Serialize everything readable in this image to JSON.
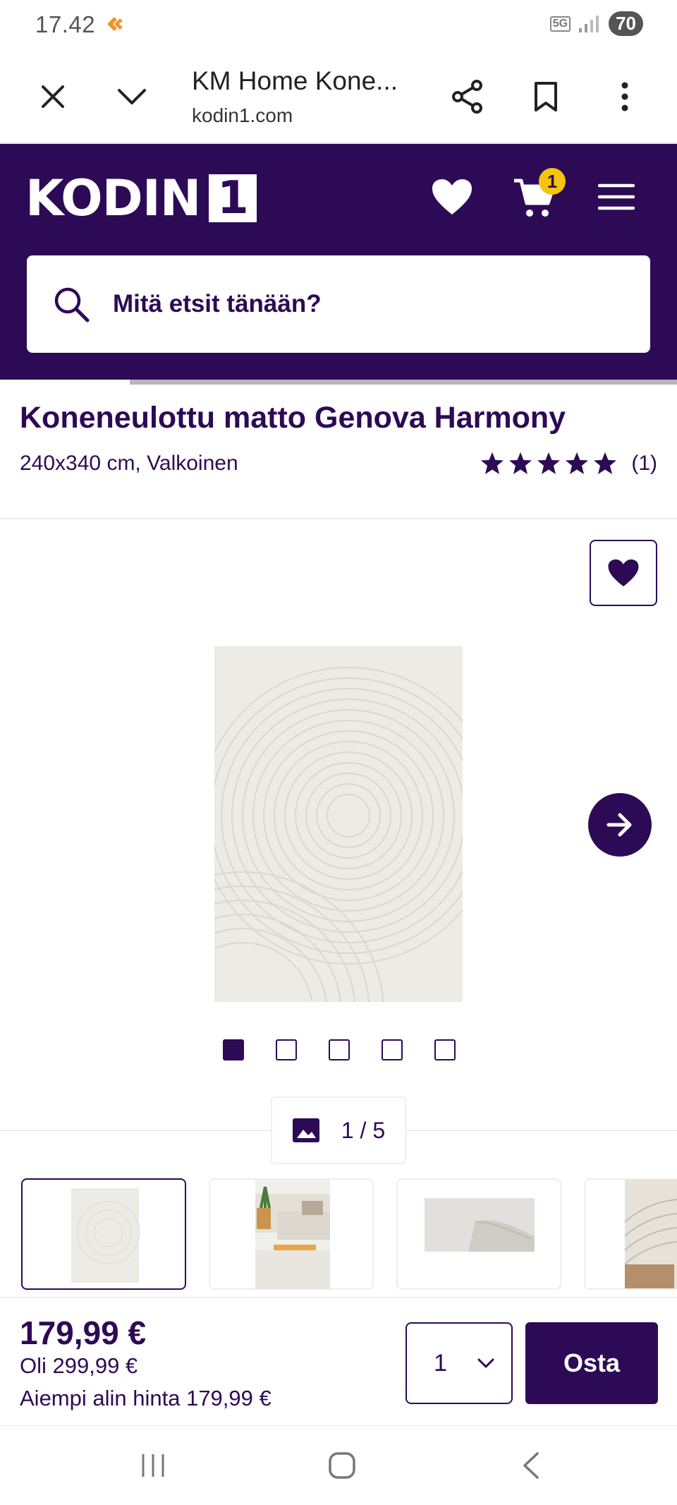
{
  "status_bar": {
    "time": "17.42",
    "network": "5G",
    "battery": "70"
  },
  "browser": {
    "title": "KM Home Kone...",
    "url": "kodin1.com"
  },
  "site": {
    "logo_text": "KODIN",
    "logo_box": "1",
    "cart_count": "1",
    "search_placeholder": "Mitä etsit tänään?",
    "brand_color": "#2d0a55",
    "badge_color": "#f6c30d"
  },
  "product": {
    "title": "Koneneulottu matto Genova Harmony",
    "subtitle": "240x340 cm, Valkoinen",
    "rating": 5,
    "rating_count": "(1)"
  },
  "gallery": {
    "counter": "1 / 5",
    "total_images": 5,
    "active_index": 0
  },
  "buy": {
    "price": "179,99 €",
    "was_price": "Oli 299,99 €",
    "lowest_price": "Aiempi alin hinta 179,99 €",
    "quantity": "1",
    "buy_label": "Osta"
  },
  "icons": {
    "close": "close-icon",
    "dropdown": "chevron-down-icon",
    "share": "share-icon",
    "bookmark": "bookmark-icon",
    "more": "more-vert-icon",
    "favorite": "heart-icon",
    "cart": "cart-icon",
    "menu": "hamburger-icon",
    "search": "search-icon",
    "next": "arrow-right-icon",
    "image": "image-icon"
  }
}
